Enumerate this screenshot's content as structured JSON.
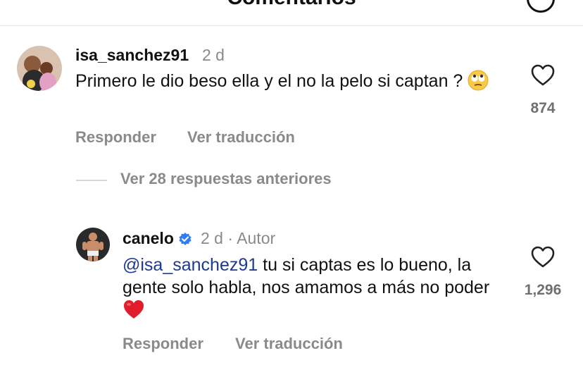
{
  "header": {
    "title": "Comentarios",
    "icon": "share-icon"
  },
  "comments": [
    {
      "username": "isa_sanchez91",
      "time": "2 d",
      "text": "Primero le dio beso ella y el no la pelo si captan ?",
      "emoji": "face-with-rolling-eyes",
      "likes": "874",
      "reply_label": "Responder",
      "translate_label": "Ver traducción"
    }
  ],
  "view_replies": "Ver 28 respuestas anteriores",
  "reply": {
    "username": "canelo",
    "verified": true,
    "time": "2 d",
    "separator": "·",
    "author_label": "Autor",
    "mention": "@isa_sanchez91",
    "text": " tu si captas es lo bueno, la gente solo habla, nos amamos a más no poder",
    "emoji": "red-heart",
    "likes": "1,296",
    "reply_label": "Responder",
    "translate_label": "Ver traducción"
  },
  "colors": {
    "mention": "#1c3a8f",
    "verified": "#2f7df6",
    "heart_emoji": "#e01e2b",
    "muted": "#8a8a8a"
  }
}
